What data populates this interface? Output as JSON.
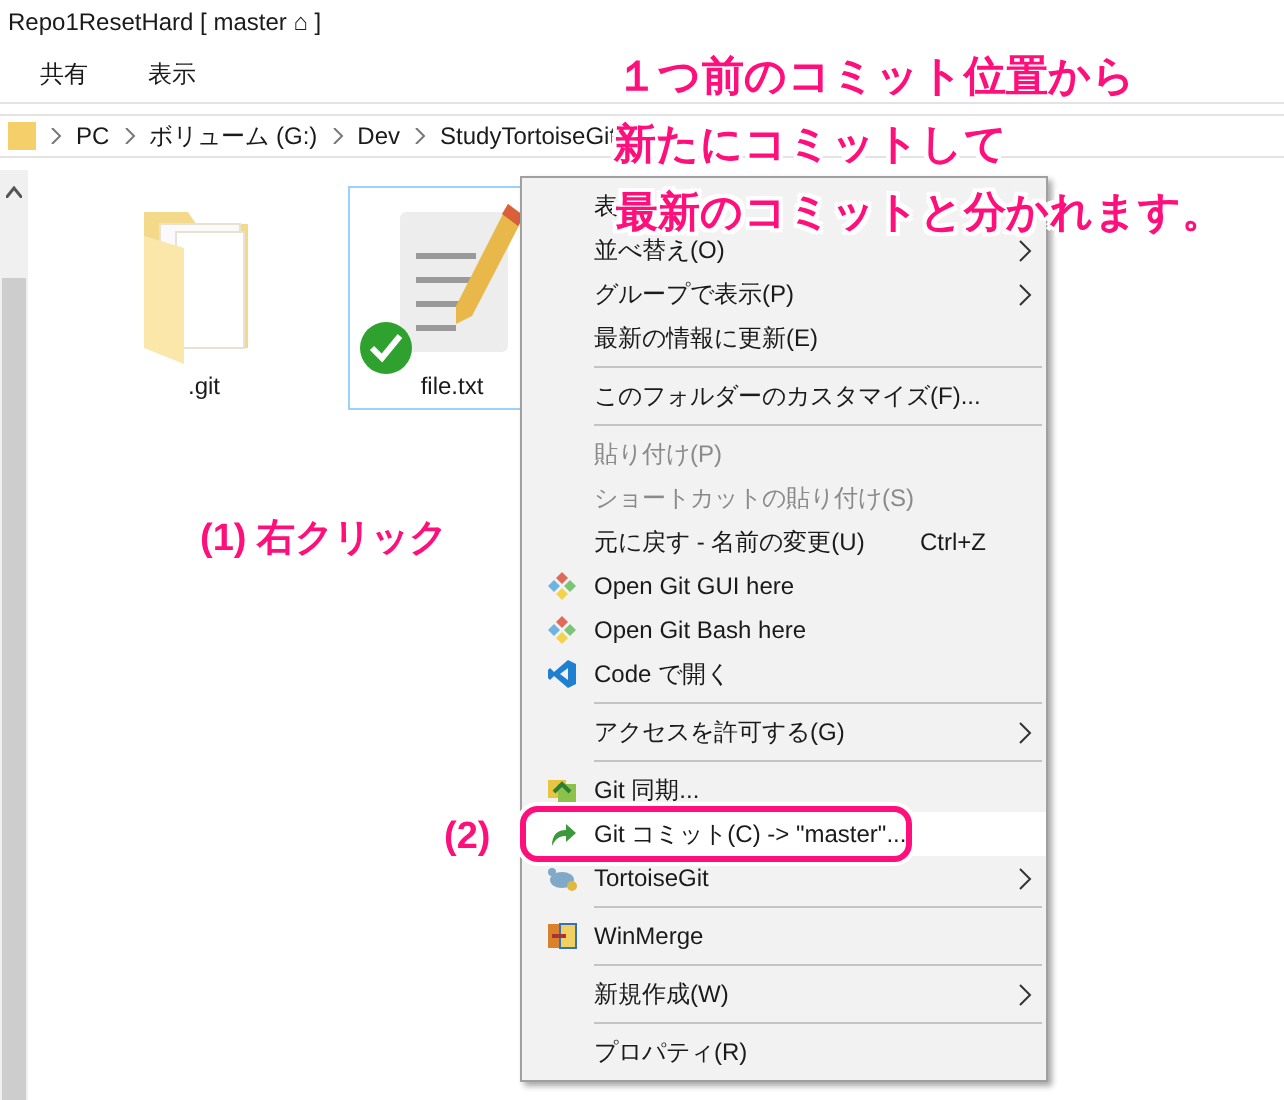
{
  "window": {
    "title": "Repo1ResetHard [ master ⌂ ]"
  },
  "ribbon_tabs": [
    {
      "label": "共有"
    },
    {
      "label": "表示"
    }
  ],
  "address_bar": {
    "crumbs": [
      "PC",
      "ボリューム (G:)",
      "Dev",
      "StudyTortoiseGit"
    ]
  },
  "files": [
    {
      "name": ".git",
      "kind": "folder",
      "selected": false,
      "synced": false
    },
    {
      "name": "file.txt",
      "kind": "text",
      "selected": true,
      "synced": true
    }
  ],
  "context_menu": {
    "items": [
      {
        "kind": "item",
        "label": "表",
        "disabled": false,
        "highlighted": false
      },
      {
        "kind": "item",
        "label": "並べ替え(O)",
        "disabled": false,
        "submenu": true,
        "highlighted": false
      },
      {
        "kind": "item",
        "label": "グループで表示(P)",
        "disabled": false,
        "submenu": true,
        "highlighted": false
      },
      {
        "kind": "item",
        "label": "最新の情報に更新(E)",
        "disabled": false,
        "submenu": false,
        "highlighted": false
      },
      {
        "kind": "separator"
      },
      {
        "kind": "item",
        "label": "このフォルダーのカスタマイズ(F)...",
        "disabled": false,
        "submenu": false,
        "highlighted": false
      },
      {
        "kind": "separator"
      },
      {
        "kind": "item",
        "label": "貼り付け(P)",
        "disabled": true,
        "submenu": false,
        "highlighted": false
      },
      {
        "kind": "item",
        "label": "ショートカットの貼り付け(S)",
        "disabled": true,
        "submenu": false,
        "highlighted": false
      },
      {
        "kind": "item",
        "label": "元に戻す - 名前の変更(U)",
        "shortcut": "Ctrl+Z",
        "disabled": false,
        "submenu": false,
        "highlighted": false
      },
      {
        "kind": "icon_item",
        "label": "Open Git GUI here",
        "disabled": false,
        "submenu": false,
        "highlighted": false
      },
      {
        "kind": "icon_item",
        "label": "Open Git Bash here",
        "disabled": false,
        "submenu": false,
        "highlighted": false
      },
      {
        "kind": "icon_item",
        "label": "Code で開く",
        "disabled": false,
        "submenu": false,
        "highlighted": false
      },
      {
        "kind": "separator"
      },
      {
        "kind": "item",
        "label": "アクセスを許可する(G)",
        "disabled": false,
        "submenu": true,
        "highlighted": false
      },
      {
        "kind": "separator"
      },
      {
        "kind": "icon_item",
        "label": "Git 同期...",
        "disabled": false,
        "submenu": false,
        "highlighted": false
      },
      {
        "kind": "icon_item",
        "label": "Git コミット(C) -> \"master\"...",
        "disabled": false,
        "submenu": false,
        "highlighted": true
      },
      {
        "kind": "icon_item",
        "label": "TortoiseGit",
        "disabled": false,
        "submenu": true,
        "highlighted": false
      },
      {
        "kind": "separator"
      },
      {
        "kind": "icon_item",
        "label": "WinMerge",
        "disabled": false,
        "submenu": false,
        "highlighted": false
      },
      {
        "kind": "separator"
      },
      {
        "kind": "item",
        "label": "新規作成(W)",
        "disabled": false,
        "submenu": true,
        "highlighted": false
      },
      {
        "kind": "separator"
      },
      {
        "kind": "item",
        "label": "プロパティ(R)",
        "disabled": false,
        "submenu": false,
        "highlighted": false
      }
    ]
  },
  "annotations": [
    {
      "kind": "note",
      "text": "１つ前のコミット位置から"
    },
    {
      "kind": "note",
      "text": "新たにコミットして"
    },
    {
      "kind": "note",
      "text": "最新のコミットと分かれます。"
    },
    {
      "kind": "step",
      "text": "(1) 右クリック"
    },
    {
      "kind": "step",
      "text": "(2)"
    }
  ]
}
